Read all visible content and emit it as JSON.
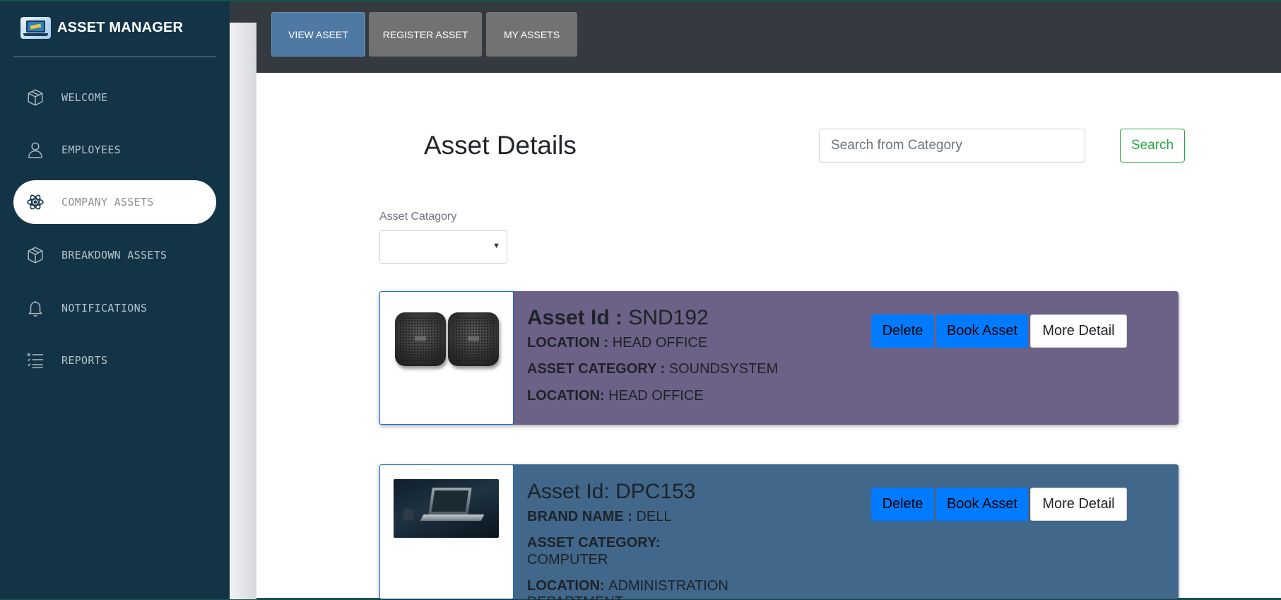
{
  "app": {
    "title": "ASSET MANAGER"
  },
  "sidebar": {
    "items": [
      {
        "label": "WELCOME",
        "icon": "box-icon",
        "active": false
      },
      {
        "label": "EMPLOYEES",
        "icon": "user-icon",
        "active": false
      },
      {
        "label": "COMPANY ASSETS",
        "icon": "atom-icon",
        "active": true
      },
      {
        "label": "BREAKDOWN ASSETS",
        "icon": "box-icon",
        "active": false
      },
      {
        "label": "NOTIFICATIONS",
        "icon": "bell-icon",
        "active": false
      },
      {
        "label": "REPORTS",
        "icon": "list-icon",
        "active": false
      }
    ]
  },
  "topbar": {
    "tabs": [
      {
        "label": "VIEW ASEET",
        "active": true
      },
      {
        "label": "REGISTER ASSET",
        "active": false
      },
      {
        "label": "MY ASSETS",
        "active": false
      }
    ]
  },
  "main": {
    "title": "Asset Details",
    "search": {
      "placeholder": "Search from Category",
      "value": "",
      "button_label": "Search"
    },
    "category_filter": {
      "label": "Asset Catagory",
      "selected": ""
    }
  },
  "assets": [
    {
      "id_label": "Asset Id : ",
      "id_value": "SND192",
      "lines": [
        {
          "key": "LOCATION : ",
          "value": "HEAD OFFICE"
        },
        {
          "key": "ASSET CATEGORY : ",
          "value": "SOUNDSYSTEM"
        },
        {
          "key": "LOCATION: ",
          "value": "HEAD OFFICE"
        }
      ],
      "image": "speaker-pair-image",
      "card_color": "#6c6186"
    },
    {
      "id_label": "Asset Id: ",
      "id_value": "DPC153",
      "lines": [
        {
          "key": "BRAND NAME : ",
          "value": "DELL"
        },
        {
          "key": "ASSET CATEGORY: ",
          "value": "COMPUTER"
        },
        {
          "key": "LOCATION: ",
          "value": "ADMINISTRATION DEPARTMENT"
        }
      ],
      "image": "laptop-image",
      "card_color": "#41678b"
    }
  ],
  "actions": {
    "delete": "Delete",
    "book": "Book Asset",
    "details": "More Detail"
  },
  "colors": {
    "sidebar": "#133447",
    "topbar": "#343a40",
    "tab_active": "#4e79a3",
    "tab_inactive": "#727272",
    "primary_button": "#007bff",
    "success_outline": "#28a745"
  }
}
